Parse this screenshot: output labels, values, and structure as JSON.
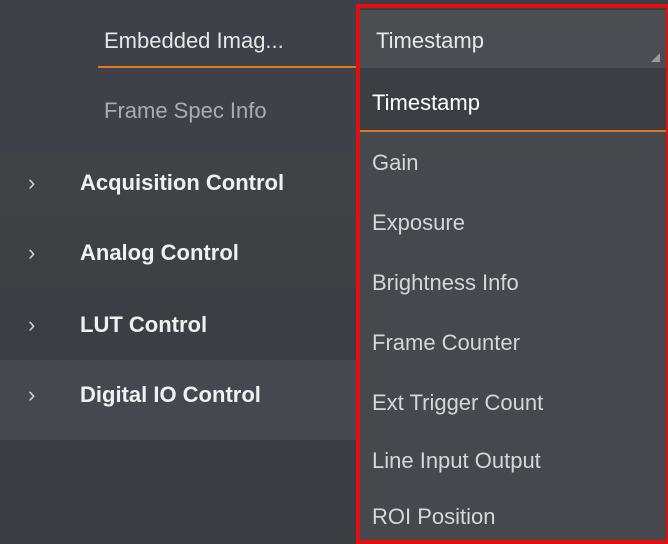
{
  "properties": {
    "embedded_label": "Embedded Imag...",
    "frame_spec_label": "Frame Spec Info"
  },
  "groups": [
    {
      "label": "Acquisition Control"
    },
    {
      "label": "Analog Control"
    },
    {
      "label": "LUT Control"
    },
    {
      "label": "Digital IO Control"
    }
  ],
  "combo": {
    "value": "Timestamp"
  },
  "dropdown": {
    "options": [
      "Timestamp",
      "Gain",
      "Exposure",
      "Brightness Info",
      "Frame Counter",
      "Ext Trigger Count",
      "Line Input Output",
      "ROI Position"
    ],
    "selected": "Timestamp"
  },
  "colors": {
    "accent": "#e07820",
    "highlight": "#e01010",
    "background": "#3a3d42"
  },
  "icons": {
    "expand": "chevron-right-icon",
    "combo_arrow": "dropdown-corner-icon"
  }
}
